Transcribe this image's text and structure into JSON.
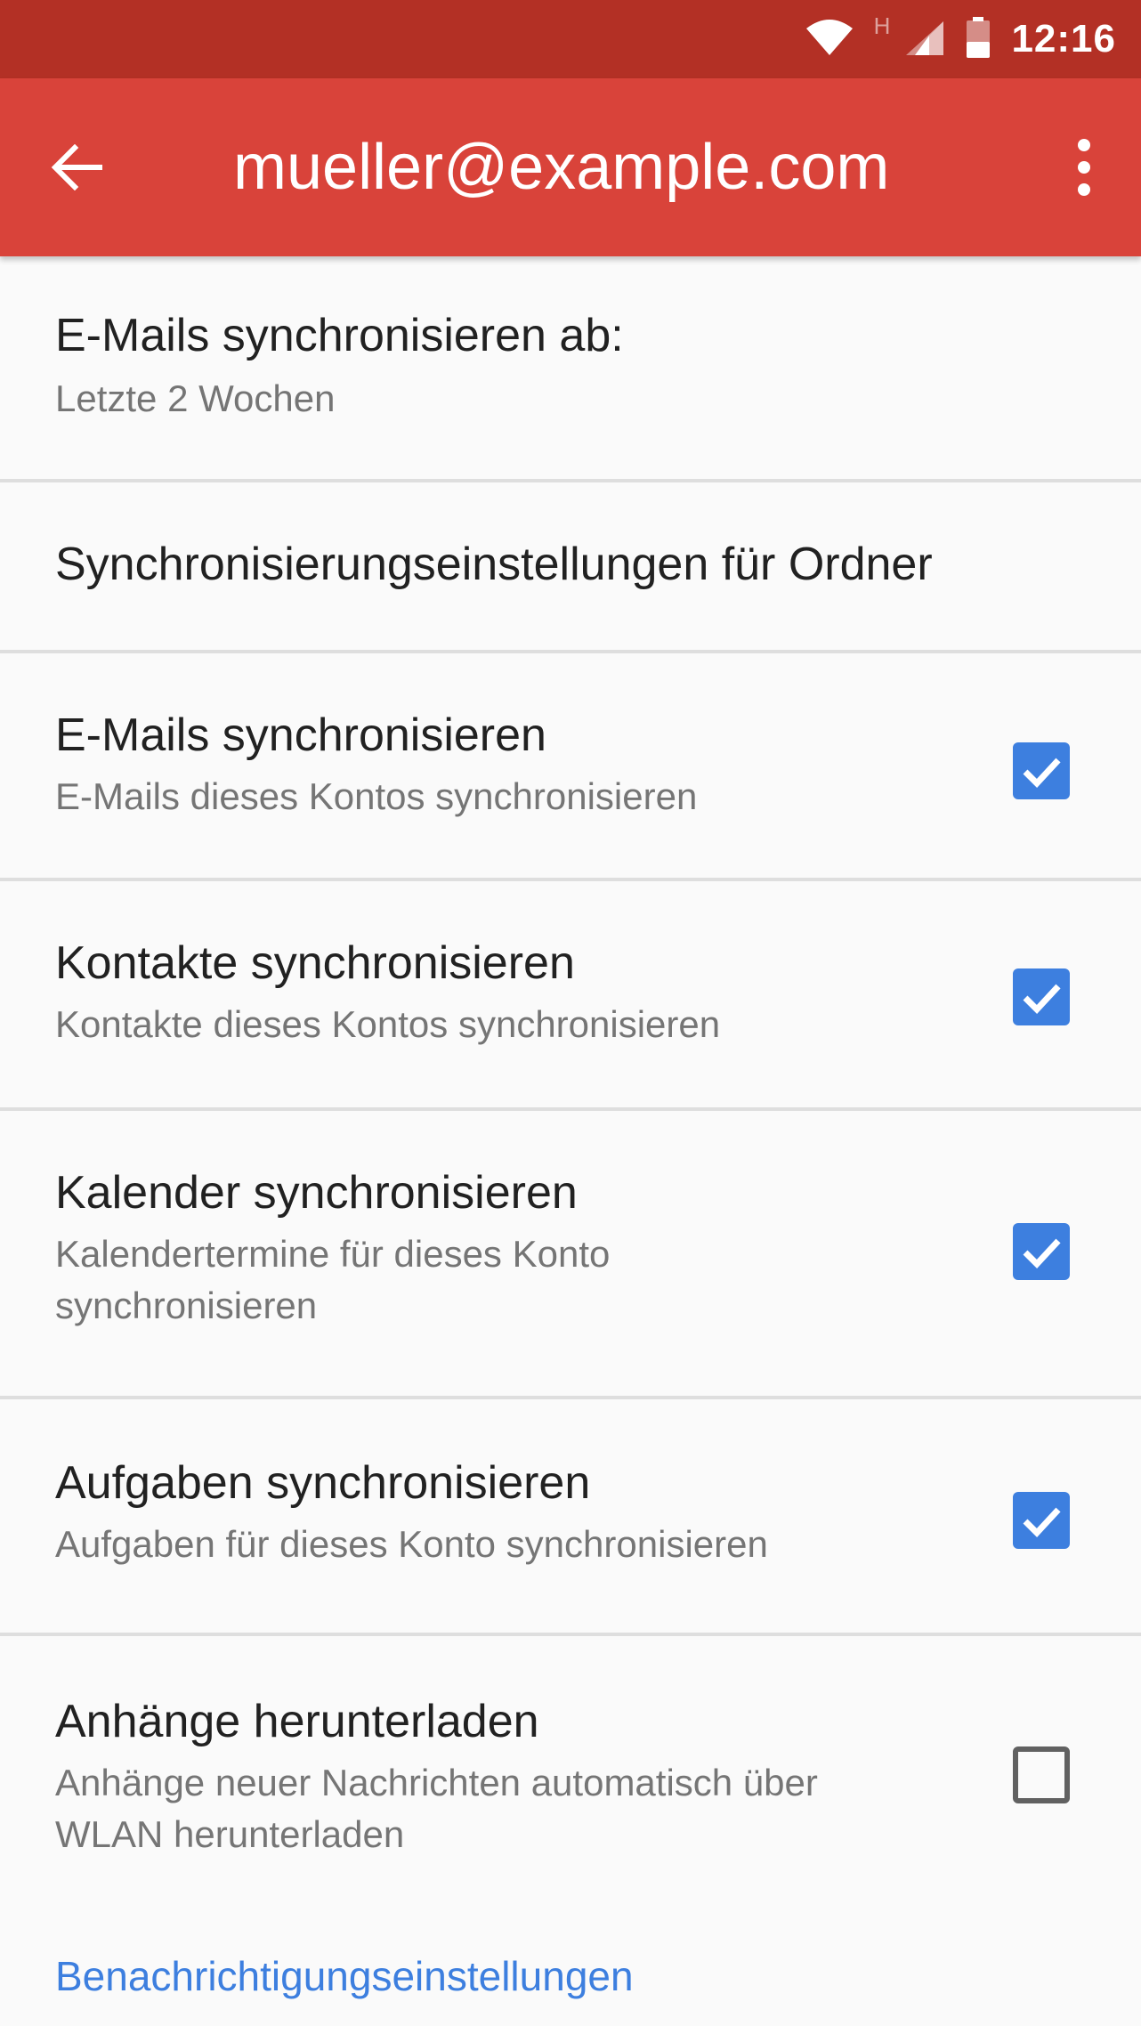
{
  "status_bar": {
    "time": "12:16",
    "network_type": "H",
    "icons": [
      "wifi-icon",
      "signal-icon",
      "battery-icon"
    ]
  },
  "app_bar": {
    "title": "mueller@example.com",
    "back_icon": "arrow-back-icon",
    "menu_icon": "more-vert-icon",
    "color": "#d9433a"
  },
  "settings": {
    "sync_range": {
      "title": "E-Mails synchronisieren ab:",
      "value": "Letzte 2 Wochen"
    },
    "folder_sync": {
      "title": "Synchronisierungseinstellungen für Ordner"
    },
    "sync_email": {
      "title": "E-Mails synchronisieren",
      "subtitle": "E-Mails dieses Kontos synchronisieren",
      "checked": true
    },
    "sync_contacts": {
      "title": "Kontakte synchronisieren",
      "subtitle": "Kontakte dieses Kontos synchronisieren",
      "checked": true
    },
    "sync_calendar": {
      "title": "Kalender synchronisieren",
      "subtitle": "Kalendertermine für dieses Konto synchronisieren",
      "checked": true
    },
    "sync_tasks": {
      "title": "Aufgaben synchronisieren",
      "subtitle": "Aufgaben für dieses Konto synchronisieren",
      "checked": true
    },
    "download_attachments": {
      "title": "Anhänge herunterladen",
      "subtitle": "Anhänge neuer Nachrichten automatisch über WLAN herunterladen",
      "checked": false
    },
    "notification_link": "Benachrichtigungseinstellungen"
  },
  "colors": {
    "status_bar": "#b33025",
    "accent": "#3d7fdf"
  }
}
